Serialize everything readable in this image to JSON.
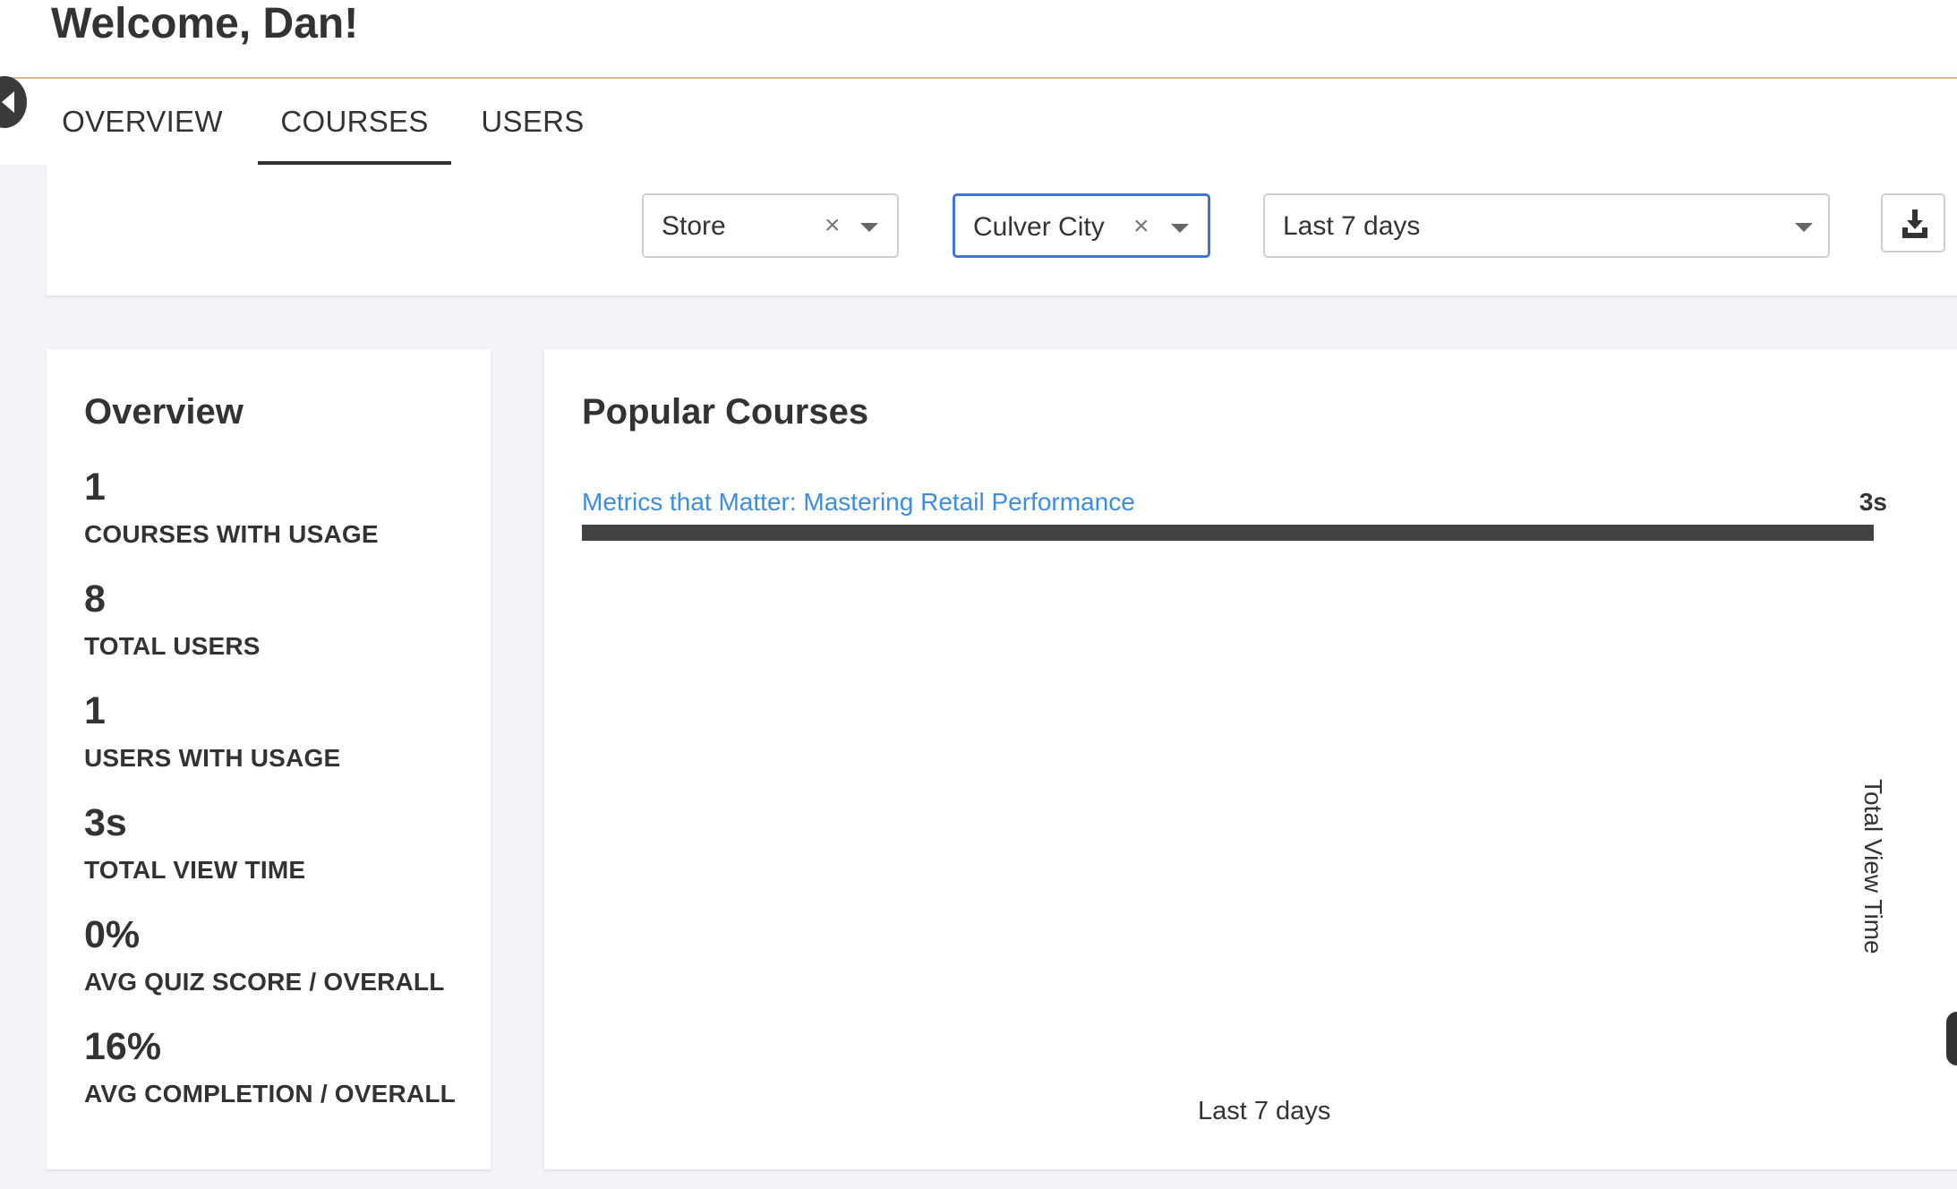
{
  "header": {
    "welcome": "Welcome, Dan!"
  },
  "tabs": [
    {
      "label": "OVERVIEW",
      "active": false
    },
    {
      "label": "COURSES",
      "active": true
    },
    {
      "label": "USERS",
      "active": false
    }
  ],
  "filters": {
    "store": {
      "value": "Store",
      "clear": "×"
    },
    "location": {
      "value": "Culver City",
      "clear": "×"
    },
    "date_range": {
      "value": "Last 7 days"
    }
  },
  "overview": {
    "title": "Overview",
    "stats": [
      {
        "value": "1",
        "label": "COURSES WITH USAGE"
      },
      {
        "value": "8",
        "label": "TOTAL USERS"
      },
      {
        "value": "1",
        "label": "USERS WITH USAGE"
      },
      {
        "value": "3s",
        "label": "TOTAL VIEW TIME"
      },
      {
        "value": "0%",
        "label": "AVG QUIZ SCORE / OVERALL"
      },
      {
        "value": "16%",
        "label": "AVG COMPLETION / OVERALL"
      }
    ]
  },
  "popular": {
    "title": "Popular Courses",
    "y_axis_label": "Total View Time",
    "x_axis_label": "Last 7 days"
  },
  "chart_data": {
    "type": "bar",
    "categories": [
      "Metrics that Matter: Mastering Retail Performance"
    ],
    "values": [
      3
    ],
    "value_labels": [
      "3s"
    ],
    "xlabel": "Last 7 days",
    "ylabel": "Total View Time",
    "max": 3
  },
  "colors": {
    "accent_link": "#3b8ee0",
    "bar": "#424242",
    "focus": "#3f76d6",
    "header_border": "#d7b98a"
  },
  "icons": {
    "collapse": "chevron-left-icon",
    "download": "download-icon",
    "clear": "close-icon",
    "caret": "caret-down-icon"
  }
}
